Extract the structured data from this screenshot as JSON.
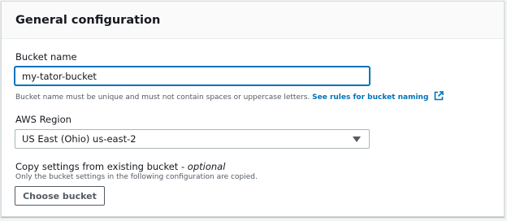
{
  "panel": {
    "title": "General configuration"
  },
  "bucket_name": {
    "label": "Bucket name",
    "value": "my-tator-bucket",
    "hint": "Bucket name must be unique and must not contain spaces or uppercase letters.",
    "rules_link": "See rules for bucket naming",
    "rules_icon": "external-link-icon"
  },
  "region": {
    "label": "AWS Region",
    "selected": "US East (Ohio) us-east-2"
  },
  "copy_settings": {
    "label": "Copy settings from existing bucket - ",
    "optional": "optional",
    "description": "Only the bucket settings in the following configuration are copied.",
    "button_label": "Choose bucket"
  },
  "colors": {
    "link": "#0073bb",
    "focus_border": "#0073bb",
    "text": "#16191f",
    "muted": "#545b64"
  }
}
